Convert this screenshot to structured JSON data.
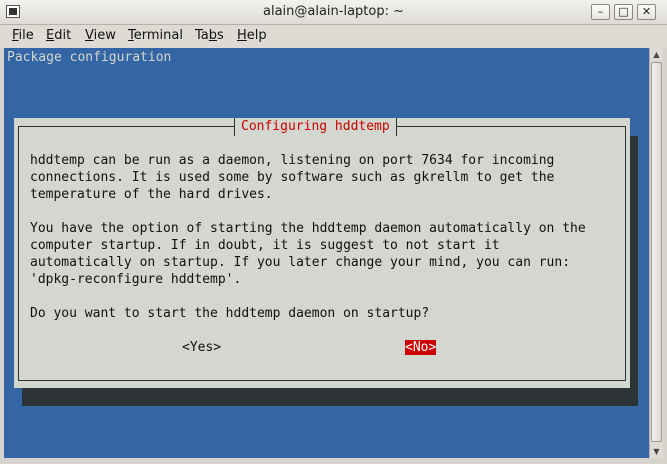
{
  "window": {
    "title": "alain@alain-laptop: ~",
    "minimize": "–",
    "maximize": "□",
    "close": "✕"
  },
  "menubar": [
    {
      "mnemonic": "F",
      "rest": "ile"
    },
    {
      "mnemonic": "E",
      "rest": "dit"
    },
    {
      "mnemonic": "V",
      "rest": "iew"
    },
    {
      "mnemonic": "T",
      "rest": "erminal"
    },
    {
      "pre": "Ta",
      "mnemonic": "b",
      "rest": "s"
    },
    {
      "mnemonic": "H",
      "rest": "elp"
    }
  ],
  "terminal": {
    "header": "Package configuration",
    "dialog": {
      "title": "Configuring hddtemp",
      "text": "hddtemp can be run as a daemon, listening on port 7634 for incoming\nconnections. It is used some by software such as gkrellm to get the\ntemperature of the hard drives.\n\nYou have the option of starting the hddtemp daemon automatically on the\ncomputer startup. If in doubt, it is suggest to not start it\nautomatically on startup. If you later change your mind, you can run:\n'dpkg-reconfigure hddtemp'.\n\nDo you want to start the hddtemp daemon on startup?",
      "yes_label": "<Yes>",
      "no_label": "<No>"
    }
  },
  "scrollbar": {
    "up": "▲",
    "down": "▼"
  },
  "colors": {
    "terminal_bg": "#3465a4",
    "dialog_bg": "#d3d7cf",
    "title_red": "#cc0000",
    "shadow": "#2e3436"
  }
}
